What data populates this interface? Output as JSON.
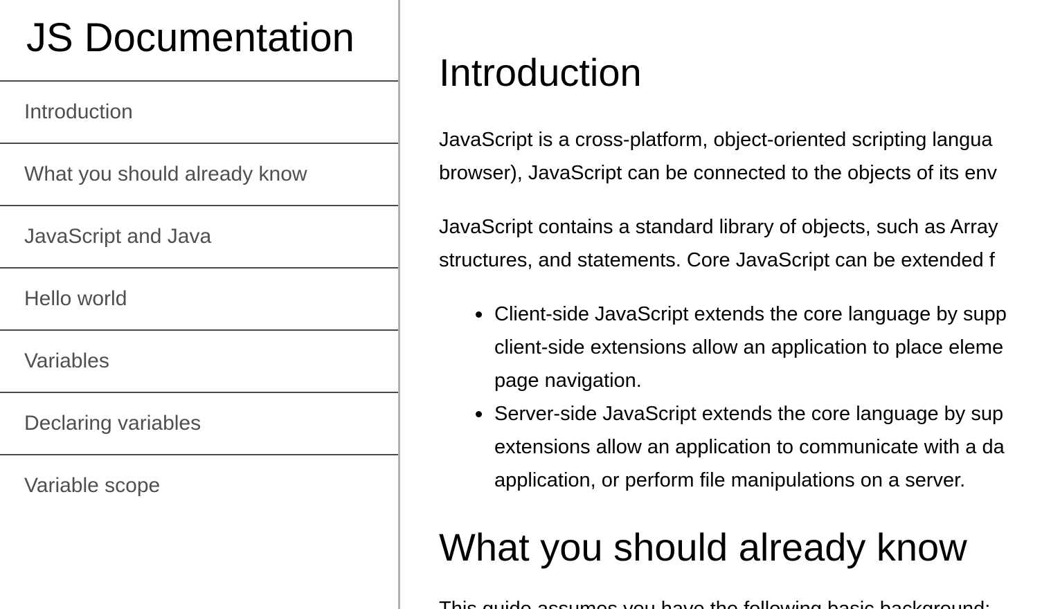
{
  "sidebar": {
    "title": "JS Documentation",
    "items": [
      {
        "label": "Introduction"
      },
      {
        "label": "What you should already know"
      },
      {
        "label": "JavaScript and Java"
      },
      {
        "label": "Hello world"
      },
      {
        "label": "Variables"
      },
      {
        "label": "Declaring variables"
      },
      {
        "label": "Variable scope"
      }
    ]
  },
  "main": {
    "intro": {
      "title": "Introduction",
      "p1": [
        "JavaScript is a cross-platform, object-oriented scripting langua",
        "browser), JavaScript can be connected to the objects of its env"
      ],
      "p2": [
        "JavaScript contains a standard library of objects, such as Array",
        "structures, and statements. Core JavaScript can be extended f"
      ],
      "list": [
        [
          "Client-side JavaScript extends the core language by supp",
          "client-side extensions allow an application to place eleme",
          "page navigation."
        ],
        [
          "Server-side JavaScript extends the core language by sup",
          "extensions allow an application to communicate with a da",
          "application, or perform file manipulations on a server."
        ]
      ]
    },
    "know": {
      "title": "What you should already know",
      "p1_partial": "This guide assumes you have the following basic background:"
    }
  }
}
